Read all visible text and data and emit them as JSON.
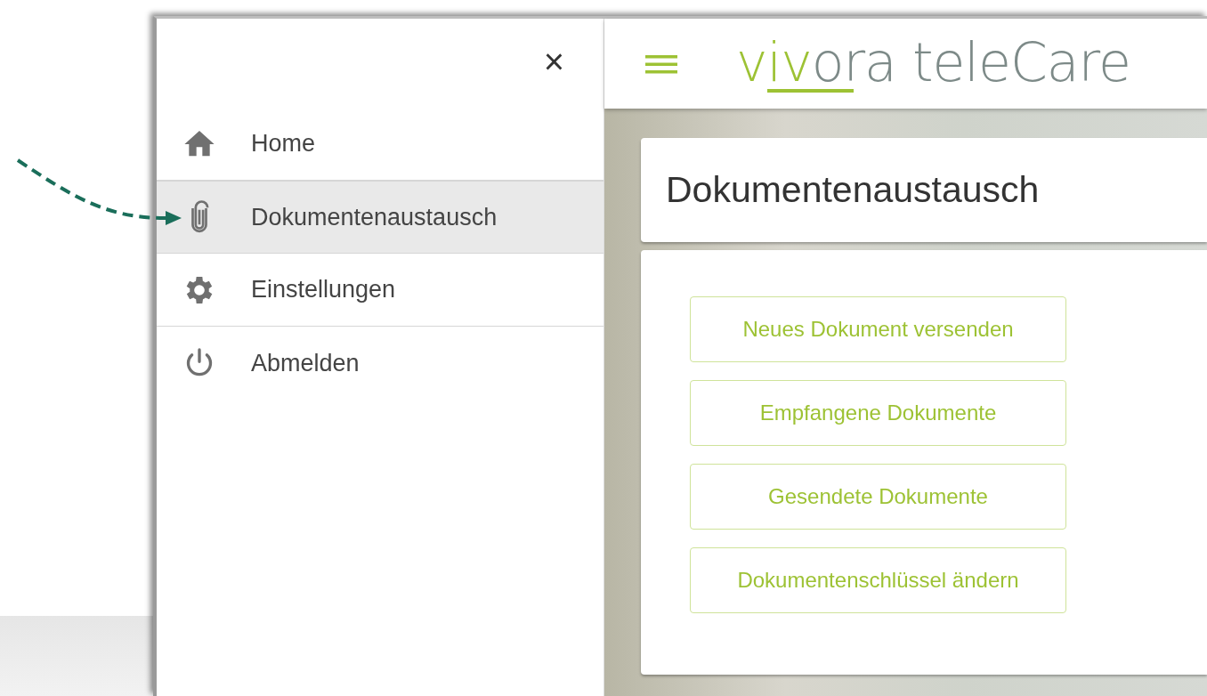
{
  "sidebar": {
    "close": "×",
    "items": [
      {
        "kind": "home",
        "label": "Home",
        "selected": false
      },
      {
        "kind": "attachment",
        "label": "Dokumentenaustausch",
        "selected": true
      },
      {
        "kind": "settings",
        "label": "Einstellungen",
        "selected": false
      },
      {
        "kind": "power",
        "label": "Abmelden",
        "selected": false
      }
    ]
  },
  "header": {
    "logo": {
      "accent": "viv",
      "rest": "ora",
      "product": "teleCare"
    }
  },
  "page": {
    "title": "Dokumentenaustausch",
    "buttons": [
      "Neues Dokument versenden",
      "Empfangene Dokumente",
      "Gesendete Dokumente",
      "Dokumentenschlüssel ändern"
    ]
  }
}
